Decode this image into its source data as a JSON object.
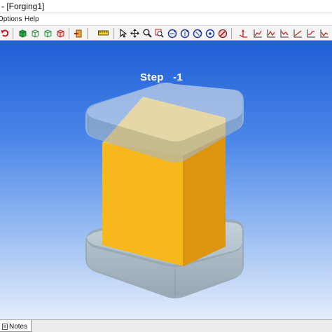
{
  "window": {
    "title": "- [Forging1]"
  },
  "menu": {
    "items": [
      "Options",
      "Help"
    ]
  },
  "toolbar": {
    "icons": [
      "undo-icon",
      "shaded-view-icon",
      "wireframe-view-icon",
      "hidden-line-icon",
      "section-view-icon",
      "exit-icon",
      "ruler-icon",
      "select-pointer-icon",
      "pan-icon",
      "zoom-icon",
      "zoom-window-icon",
      "rotate-x-icon",
      "rotate-y-icon",
      "rotate-z-icon",
      "rotate-free-icon",
      "fit-view-icon",
      "axes-icon",
      "graph-1-icon",
      "graph-2-icon",
      "graph-3-icon",
      "graph-4-icon",
      "graph-5-icon",
      "graph-6-icon"
    ]
  },
  "viewport": {
    "step_label": "Step   -1"
  },
  "bottom": {
    "notes_tab": "Notes"
  },
  "colors": {
    "billet": "#f5b21c",
    "die": "#a9bcc8",
    "background_top": "#1f5fd6",
    "background_bottom": "#e4edfb"
  }
}
